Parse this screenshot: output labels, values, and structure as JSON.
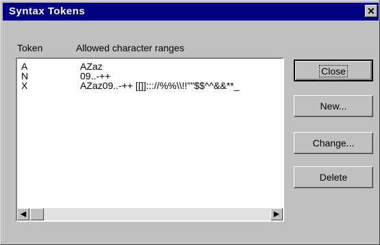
{
  "window": {
    "title": "Syntax Tokens",
    "close_glyph": "✕"
  },
  "columns": {
    "token": "Token",
    "ranges": "Allowed character ranges"
  },
  "rows": [
    {
      "token": "A",
      "ranges": "AZaz"
    },
    {
      "token": "N",
      "ranges": "09..-++"
    },
    {
      "token": "X",
      "ranges": "AZaz09..-++  [[]]::://%%\\\\!!\"\"$$^^&&**_"
    }
  ],
  "buttons": {
    "close": "Close",
    "new": "New...",
    "change": "Change...",
    "delete": "Delete"
  },
  "scroll": {
    "left_glyph": "◀",
    "right_glyph": "▶"
  }
}
